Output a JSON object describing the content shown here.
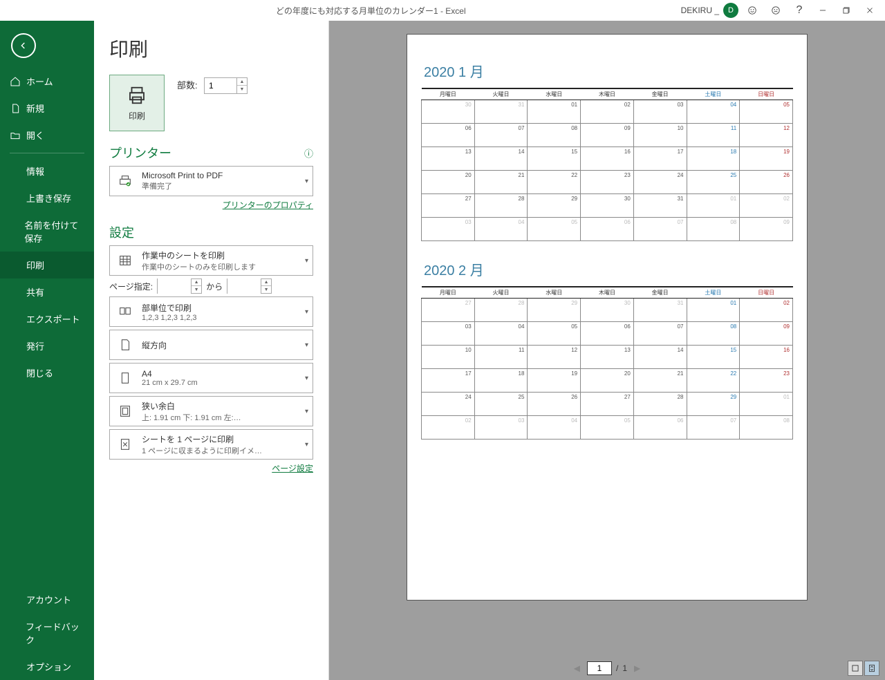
{
  "titlebar": {
    "doc_title": "どの年度にも対応する月単位のカレンダー1  -  Excel",
    "user_name": "DEKIRU _",
    "avatar_initial": "D"
  },
  "sidebar": {
    "items": [
      {
        "label": "ホーム"
      },
      {
        "label": "新規"
      },
      {
        "label": "開く"
      },
      {
        "label": "情報"
      },
      {
        "label": "上書き保存"
      },
      {
        "label": "名前を付けて保存"
      },
      {
        "label": "印刷"
      },
      {
        "label": "共有"
      },
      {
        "label": "エクスポート"
      },
      {
        "label": "発行"
      },
      {
        "label": "閉じる"
      },
      {
        "label": "アカウント"
      },
      {
        "label": "フィードバック"
      },
      {
        "label": "オプション"
      }
    ]
  },
  "page": {
    "title": "印刷",
    "print_btn": "印刷",
    "copies_label": "部数:",
    "copies_value": "1",
    "printer_heading": "プリンター",
    "printer_name": "Microsoft Print to PDF",
    "printer_status": "準備完了",
    "printer_props": "プリンターのプロパティ",
    "settings_heading": "設定",
    "what": {
      "t1": "作業中のシートを印刷",
      "t2": "作業中のシートのみを印刷します"
    },
    "page_range_label": "ページ指定:",
    "page_range_to": "から",
    "collate": {
      "t1": "部単位で印刷",
      "t2": "1,2,3    1,2,3    1,2,3"
    },
    "orient": {
      "t1": "縦方向"
    },
    "size": {
      "t1": "A4",
      "t2": "21 cm x 29.7 cm"
    },
    "margins": {
      "t1": "狭い余白",
      "t2": "上: 1.91 cm 下: 1.91 cm 左:…"
    },
    "scaling": {
      "t1": "シートを 1 ページに印刷",
      "t2": "1 ページに収まるように印刷イメ…"
    },
    "page_setup": "ページ設定"
  },
  "preview": {
    "current_page": "1",
    "sep": "/",
    "total_pages": "1",
    "weekdays": [
      "月曜日",
      "火曜日",
      "水曜日",
      "木曜日",
      "金曜日",
      "土曜日",
      "日曜日"
    ],
    "months": [
      {
        "title": "2020     1 月",
        "rows": [
          [
            {
              "n": "30",
              "o": 1
            },
            {
              "n": "31",
              "o": 1
            },
            {
              "n": "01"
            },
            {
              "n": "02"
            },
            {
              "n": "03"
            },
            {
              "n": "04",
              "s": 1
            },
            {
              "n": "05",
              "u": 1
            }
          ],
          [
            {
              "n": "06"
            },
            {
              "n": "07"
            },
            {
              "n": "08"
            },
            {
              "n": "09"
            },
            {
              "n": "10"
            },
            {
              "n": "11",
              "s": 1
            },
            {
              "n": "12",
              "u": 1
            }
          ],
          [
            {
              "n": "13"
            },
            {
              "n": "14"
            },
            {
              "n": "15"
            },
            {
              "n": "16"
            },
            {
              "n": "17"
            },
            {
              "n": "18",
              "s": 1
            },
            {
              "n": "19",
              "u": 1
            }
          ],
          [
            {
              "n": "20"
            },
            {
              "n": "21"
            },
            {
              "n": "22"
            },
            {
              "n": "23"
            },
            {
              "n": "24"
            },
            {
              "n": "25",
              "s": 1
            },
            {
              "n": "26",
              "u": 1
            }
          ],
          [
            {
              "n": "27"
            },
            {
              "n": "28"
            },
            {
              "n": "29"
            },
            {
              "n": "30"
            },
            {
              "n": "31"
            },
            {
              "n": "01",
              "o": 1
            },
            {
              "n": "02",
              "o": 1
            }
          ],
          [
            {
              "n": "03",
              "o": 1
            },
            {
              "n": "04",
              "o": 1
            },
            {
              "n": "05",
              "o": 1
            },
            {
              "n": "06",
              "o": 1
            },
            {
              "n": "07",
              "o": 1
            },
            {
              "n": "08",
              "o": 1
            },
            {
              "n": "09",
              "o": 1
            }
          ]
        ]
      },
      {
        "title": "2020     2 月",
        "rows": [
          [
            {
              "n": "27",
              "o": 1
            },
            {
              "n": "28",
              "o": 1
            },
            {
              "n": "29",
              "o": 1
            },
            {
              "n": "30",
              "o": 1
            },
            {
              "n": "31",
              "o": 1
            },
            {
              "n": "01",
              "s": 1
            },
            {
              "n": "02",
              "u": 1
            }
          ],
          [
            {
              "n": "03"
            },
            {
              "n": "04"
            },
            {
              "n": "05"
            },
            {
              "n": "06"
            },
            {
              "n": "07"
            },
            {
              "n": "08",
              "s": 1
            },
            {
              "n": "09",
              "u": 1
            }
          ],
          [
            {
              "n": "10"
            },
            {
              "n": "11"
            },
            {
              "n": "12"
            },
            {
              "n": "13"
            },
            {
              "n": "14"
            },
            {
              "n": "15",
              "s": 1
            },
            {
              "n": "16",
              "u": 1
            }
          ],
          [
            {
              "n": "17"
            },
            {
              "n": "18"
            },
            {
              "n": "19"
            },
            {
              "n": "20"
            },
            {
              "n": "21"
            },
            {
              "n": "22",
              "s": 1
            },
            {
              "n": "23",
              "u": 1
            }
          ],
          [
            {
              "n": "24"
            },
            {
              "n": "25"
            },
            {
              "n": "26"
            },
            {
              "n": "27"
            },
            {
              "n": "28"
            },
            {
              "n": "29",
              "s": 1
            },
            {
              "n": "01",
              "o": 1
            }
          ],
          [
            {
              "n": "02",
              "o": 1
            },
            {
              "n": "03",
              "o": 1
            },
            {
              "n": "04",
              "o": 1
            },
            {
              "n": "05",
              "o": 1
            },
            {
              "n": "06",
              "o": 1
            },
            {
              "n": "07",
              "o": 1
            },
            {
              "n": "08",
              "o": 1
            }
          ]
        ]
      }
    ]
  }
}
